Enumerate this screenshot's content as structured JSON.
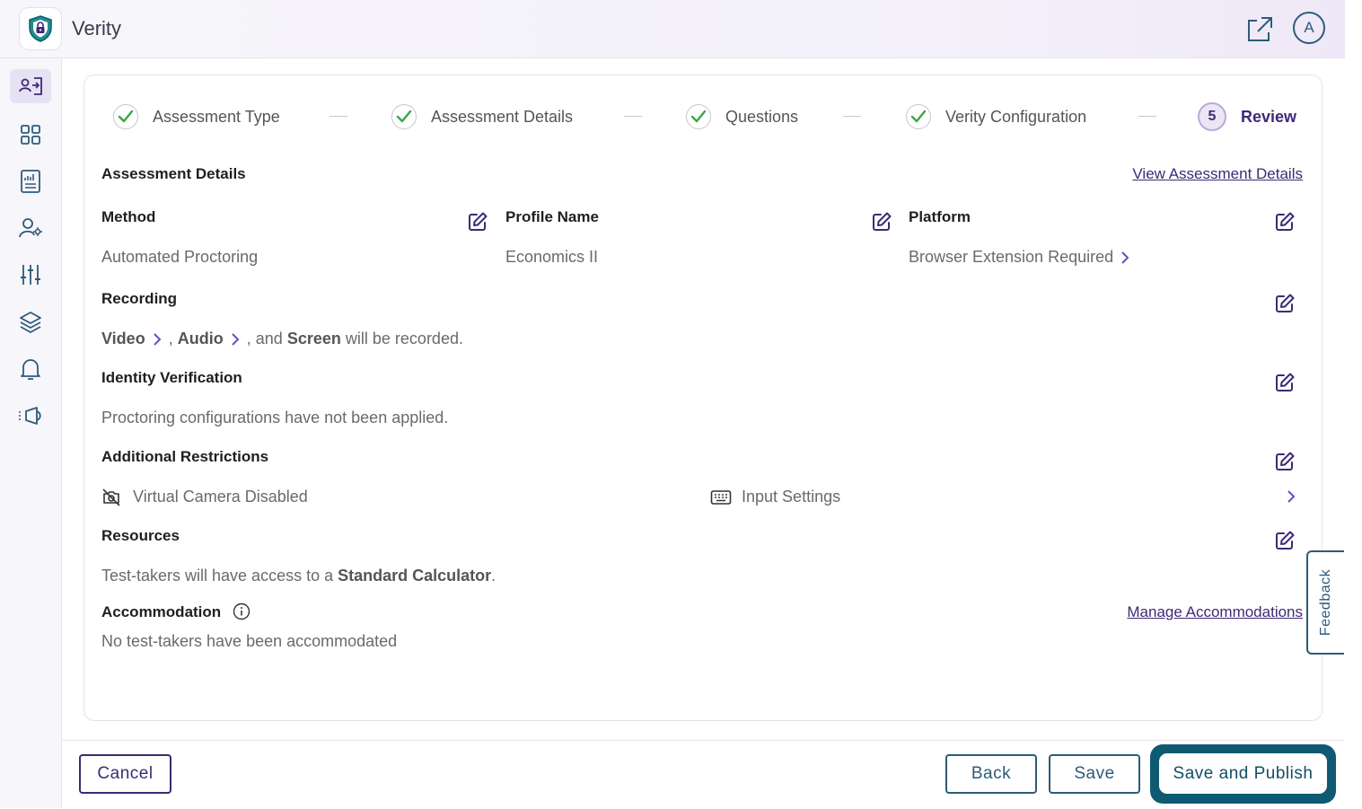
{
  "app": {
    "title": "Verity"
  },
  "header": {
    "avatar_initial": "A"
  },
  "steps": [
    {
      "label": "Assessment Type",
      "status": "done"
    },
    {
      "label": "Assessment Details",
      "status": "done"
    },
    {
      "label": "Questions",
      "status": "done"
    },
    {
      "label": "Verity Configuration",
      "status": "done"
    },
    {
      "number": "5",
      "label": "Review",
      "status": "current"
    }
  ],
  "details": {
    "heading": "Assessment Details",
    "view_link": "View Assessment Details",
    "method": {
      "label": "Method",
      "value": "Automated Proctoring"
    },
    "profile": {
      "label": "Profile Name",
      "value": "Economics II"
    },
    "platform": {
      "label": "Platform",
      "value": "Browser Extension Required"
    }
  },
  "recording": {
    "label": "Recording",
    "video": "Video",
    "sep1": ",",
    "audio": "Audio",
    "and_text": ", and",
    "screen": "Screen",
    "suffix": "will be recorded."
  },
  "identity": {
    "label": "Identity Verification",
    "value": "Proctoring configurations have not been applied."
  },
  "restrictions": {
    "label": "Additional Restrictions",
    "camera": "Virtual Camera Disabled",
    "input": "Input Settings"
  },
  "resources": {
    "label": "Resources",
    "prefix": "Test-takers will have access to a",
    "item": "Standard Calculator",
    "suffix": "."
  },
  "accommodation": {
    "label": "Accommodation",
    "link": "Manage Accommodations",
    "value": "No test-takers have been accommodated"
  },
  "buttons": {
    "cancel": "Cancel",
    "back": "Back",
    "save": "Save",
    "publish": "Save and Publish"
  },
  "feedback": "Feedback",
  "colors": {
    "primary_purple": "#3d2a76",
    "teal": "#2d5b7a",
    "check_green": "#3aa845",
    "publish_ring": "#0f5a73"
  }
}
